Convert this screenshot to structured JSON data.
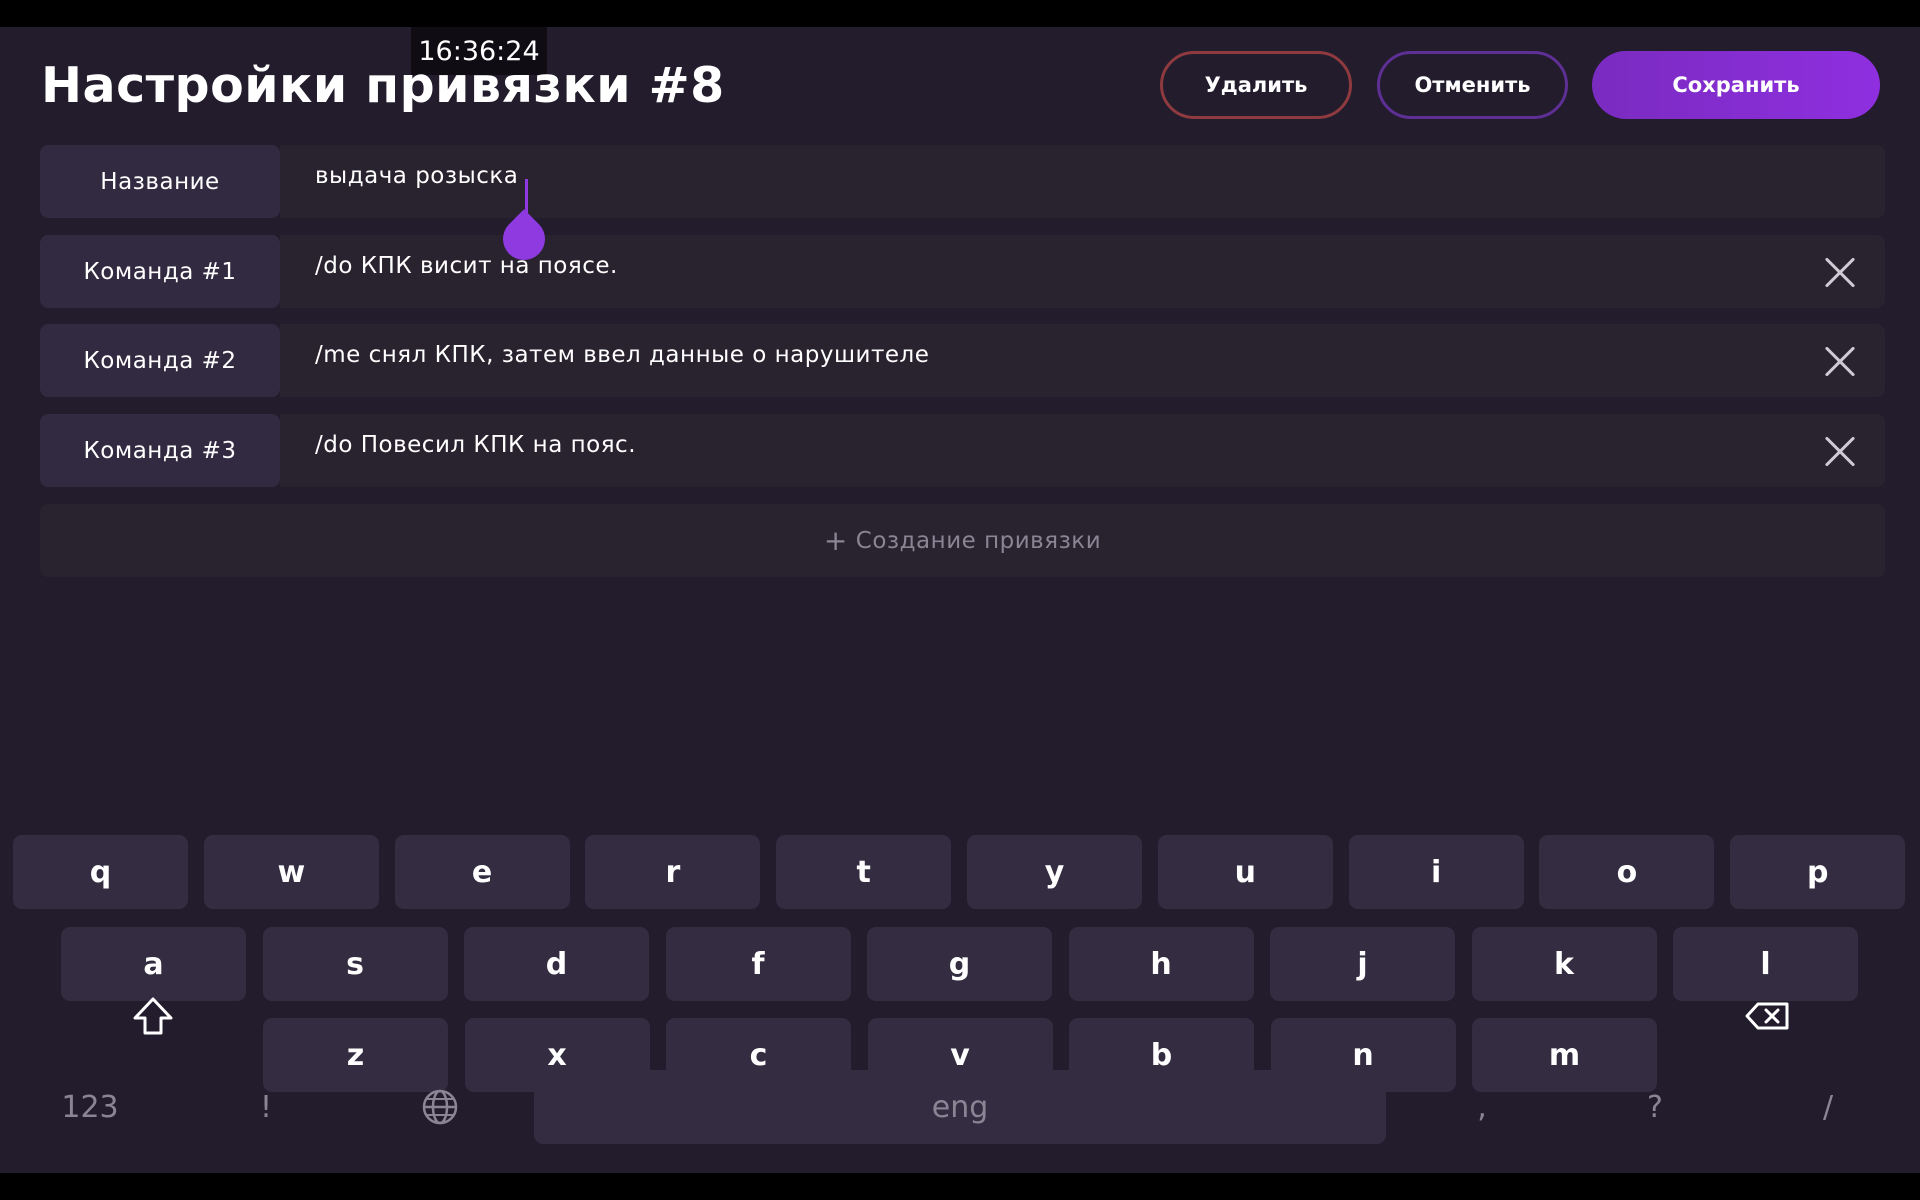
{
  "status_bar": {
    "time": "16:36:24"
  },
  "header": {
    "title": "Настройки привязки #8",
    "delete_label": "Удалить",
    "cancel_label": "Отменить",
    "save_label": "Сохранить"
  },
  "form": {
    "rows": [
      {
        "label": "Название",
        "value": "выдача розыска"
      },
      {
        "label": "Команда #1",
        "value": "/do КПК висит на поясе."
      },
      {
        "label": "Команда #2",
        "value": "/me снял КПК, затем ввел данные о нарушителе"
      },
      {
        "label": "Команда #3",
        "value": "/do Повесил КПК на пояс."
      }
    ],
    "create_label": "Создание привязки",
    "create_icon": "plus-icon"
  },
  "keyboard": {
    "row1": [
      "q",
      "w",
      "e",
      "r",
      "t",
      "y",
      "u",
      "i",
      "o",
      "p"
    ],
    "row2": [
      "a",
      "s",
      "d",
      "f",
      "g",
      "h",
      "j",
      "k",
      "l"
    ],
    "row3": [
      "z",
      "x",
      "c",
      "v",
      "b",
      "n",
      "m"
    ],
    "shift_icon": "shift-icon",
    "backspace_icon": "backspace-icon",
    "globe_icon": "globe-icon",
    "numbers_label": "123",
    "exclaim_label": "!",
    "space_label": "eng",
    "comma_label": ",",
    "question_label": "?",
    "slash_label": "/"
  },
  "colors": {
    "accent": "#8f3ae0",
    "background": "#221c2c",
    "delete_border": "#8e3a3e"
  }
}
